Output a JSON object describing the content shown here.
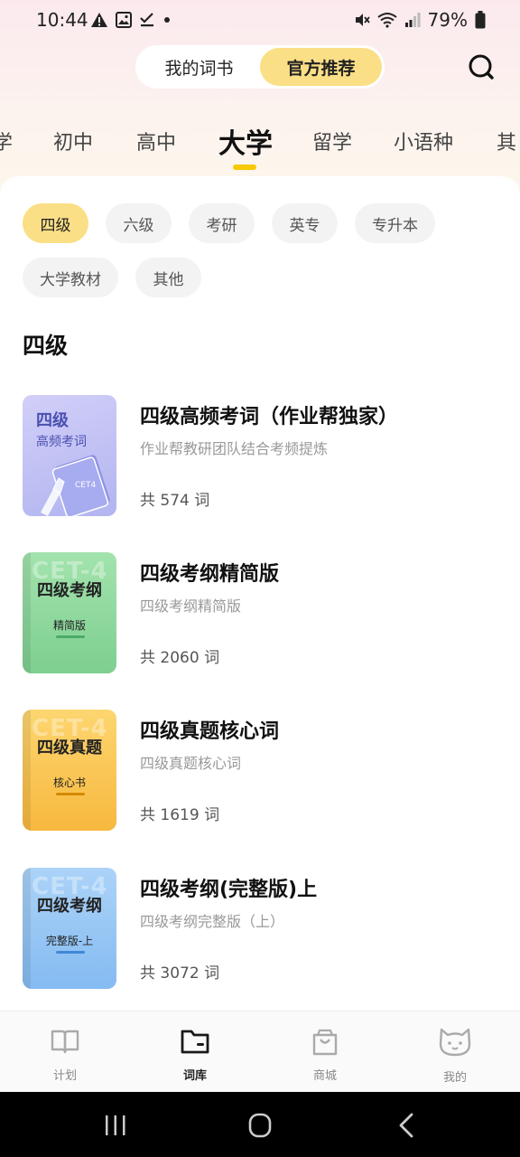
{
  "status_bar": {
    "time": "10:44",
    "battery": "79%"
  },
  "header": {
    "segments": [
      {
        "label": "我的词书"
      },
      {
        "label": "官方推荐"
      }
    ],
    "active_segment": "官方推荐",
    "search_icon": "search-icon"
  },
  "categories": {
    "tabs": [
      "学",
      "初中",
      "高中",
      "大学",
      "留学",
      "小语种",
      "其"
    ],
    "active": "大学"
  },
  "filters": {
    "chips": [
      "四级",
      "六级",
      "考研",
      "英专",
      "专升本",
      "大学教材",
      "其他"
    ],
    "active": "四级"
  },
  "section_title": "四级",
  "books": [
    {
      "title": "四级高频考词（作业帮独家）",
      "description": "作业帮教研团队结合考频提炼",
      "count": "共 574 词",
      "cover": {
        "title": "四级",
        "subtitle": "高频考词",
        "badge": "CET4",
        "colors": [
          "#c9c6f5",
          "#b3b5f0"
        ]
      }
    },
    {
      "title": "四级考纲精简版",
      "description": "四级考纲精简版",
      "count": "共 2060 词",
      "cover": {
        "title": "四级考纲",
        "subtitle": "精简版",
        "ghost": "CET-4",
        "colors": [
          "#9fe0a8",
          "#7ccf8e"
        ],
        "line": "#4caa6a"
      }
    },
    {
      "title": "四级真题核心词",
      "description": "四级真题核心词",
      "count": "共 1619 词",
      "cover": {
        "title": "四级真题",
        "subtitle": "核心书",
        "ghost": "CET-4",
        "colors": [
          "#fcd36a",
          "#f6b940"
        ],
        "line": "#d48a00"
      }
    },
    {
      "title": "四级考纲(完整版)上",
      "description": "四级考纲完整版（上）",
      "count": "共 3072 词",
      "cover": {
        "title": "四级考纲",
        "subtitle": "完整版-上",
        "ghost": "CET-4",
        "colors": [
          "#a9d1f7",
          "#86bdf2"
        ],
        "line": "#3f88d8"
      }
    }
  ],
  "bottom_nav": [
    {
      "label": "计划",
      "icon": "book-open-icon"
    },
    {
      "label": "词库",
      "icon": "folder-icon"
    },
    {
      "label": "商城",
      "icon": "shopping-bag-icon"
    },
    {
      "label": "我的",
      "icon": "cat-face-icon"
    }
  ],
  "bottom_nav_active": "词库"
}
